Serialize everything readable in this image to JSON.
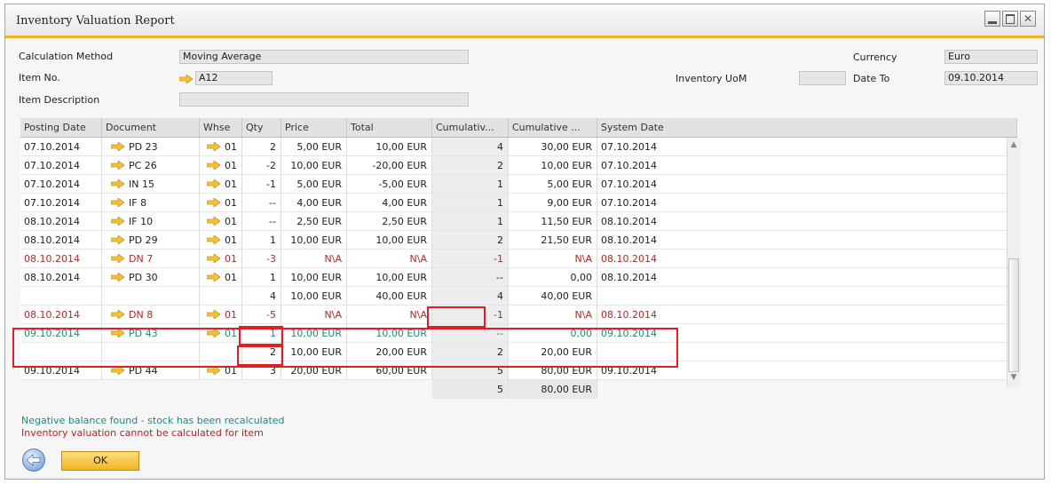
{
  "window": {
    "title": "Inventory Valuation Report"
  },
  "form": {
    "calc_method_label": "Calculation Method",
    "calc_method_value": "Moving Average",
    "item_no_label": "Item No.",
    "item_no_value": "A12",
    "item_desc_label": "Item Description",
    "item_desc_value": "",
    "uom_label": "Inventory UoM",
    "uom_value": "",
    "currency_label": "Currency",
    "currency_value": "Euro",
    "date_to_label": "Date To",
    "date_to_value": "09.10.2014"
  },
  "table": {
    "headers": [
      "Posting Date",
      "Document",
      "Whse",
      "Qty",
      "Price",
      "Total",
      "Cumulativ...",
      "Cumulative ...",
      "System Date"
    ],
    "rows": [
      {
        "posting_date": "07.10.2014",
        "document": "PD 23",
        "whse": "01",
        "qty": "2",
        "price": "5,00 EUR",
        "total": "10,00 EUR",
        "cum_qty": "4",
        "cum_val": "30,00 EUR",
        "system_date": "07.10.2014",
        "style": "normal"
      },
      {
        "posting_date": "07.10.2014",
        "document": "PC 26",
        "whse": "01",
        "qty": "-2",
        "price": "10,00 EUR",
        "total": "-20,00 EUR",
        "cum_qty": "2",
        "cum_val": "10,00 EUR",
        "system_date": "07.10.2014",
        "style": "normal"
      },
      {
        "posting_date": "07.10.2014",
        "document": "IN 15",
        "whse": "01",
        "qty": "-1",
        "price": "5,00 EUR",
        "total": "-5,00 EUR",
        "cum_qty": "1",
        "cum_val": "5,00 EUR",
        "system_date": "07.10.2014",
        "style": "normal"
      },
      {
        "posting_date": "07.10.2014",
        "document": "IF 8",
        "whse": "01",
        "qty": "--",
        "price": "4,00 EUR",
        "total": "4,00 EUR",
        "cum_qty": "1",
        "cum_val": "9,00 EUR",
        "system_date": "07.10.2014",
        "style": "normal"
      },
      {
        "posting_date": "08.10.2014",
        "document": "IF 10",
        "whse": "01",
        "qty": "--",
        "price": "2,50 EUR",
        "total": "2,50 EUR",
        "cum_qty": "1",
        "cum_val": "11,50 EUR",
        "system_date": "08.10.2014",
        "style": "normal"
      },
      {
        "posting_date": "08.10.2014",
        "document": "PD 29",
        "whse": "01",
        "qty": "1",
        "price": "10,00 EUR",
        "total": "10,00 EUR",
        "cum_qty": "2",
        "cum_val": "21,50 EUR",
        "system_date": "08.10.2014",
        "style": "normal"
      },
      {
        "posting_date": "08.10.2014",
        "document": "DN 7",
        "whse": "01",
        "qty": "-3",
        "price": "N\\A",
        "total": "N\\A",
        "cum_qty": "-1",
        "cum_val": "N\\A",
        "system_date": "08.10.2014",
        "style": "red"
      },
      {
        "posting_date": "08.10.2014",
        "document": "PD 30",
        "whse": "01",
        "qty": "1",
        "price": "10,00 EUR",
        "total": "10,00 EUR",
        "cum_qty": "--",
        "cum_val": "0,00",
        "system_date": "08.10.2014",
        "style": "normal"
      },
      {
        "posting_date": "",
        "document": "",
        "whse": "",
        "qty": "4",
        "price": "10,00 EUR",
        "total": "40,00 EUR",
        "cum_qty": "4",
        "cum_val": "40,00 EUR",
        "system_date": "",
        "style": "sub"
      },
      {
        "posting_date": "08.10.2014",
        "document": "DN 8",
        "whse": "01",
        "qty": "-5",
        "price": "N\\A",
        "total": "N\\A",
        "cum_qty": "-1",
        "cum_val": "N\\A",
        "system_date": "08.10.2014",
        "style": "red"
      },
      {
        "posting_date": "09.10.2014",
        "document": "PD 43",
        "whse": "01",
        "qty": "1",
        "price": "10,00 EUR",
        "total": "10,00 EUR",
        "cum_qty": "--",
        "cum_val": "0,00",
        "system_date": "09.10.2014",
        "style": "teal"
      },
      {
        "posting_date": "",
        "document": "",
        "whse": "",
        "qty": "2",
        "price": "10,00 EUR",
        "total": "20,00 EUR",
        "cum_qty": "2",
        "cum_val": "20,00 EUR",
        "system_date": "",
        "style": "sub"
      },
      {
        "posting_date": "09.10.2014",
        "document": "PD 44",
        "whse": "01",
        "qty": "3",
        "price": "20,00 EUR",
        "total": "60,00 EUR",
        "cum_qty": "5",
        "cum_val": "80,00 EUR",
        "system_date": "09.10.2014",
        "style": "normal"
      }
    ],
    "footer": {
      "cum_qty": "5",
      "cum_val": "80,00 EUR"
    }
  },
  "messages": {
    "negative_balance": "Negative balance found - stock has been recalculated",
    "cannot_calculate": "Inventory valuation cannot be calculated for item"
  },
  "buttons": {
    "ok": "OK"
  },
  "colors": {
    "accent": "#f0b432",
    "error": "#b52727",
    "info": "#1f8a7a",
    "highlight_box": "#e02020"
  },
  "icons": {
    "link_arrow": "link-arrow-icon",
    "back": "back-arrow-icon"
  }
}
